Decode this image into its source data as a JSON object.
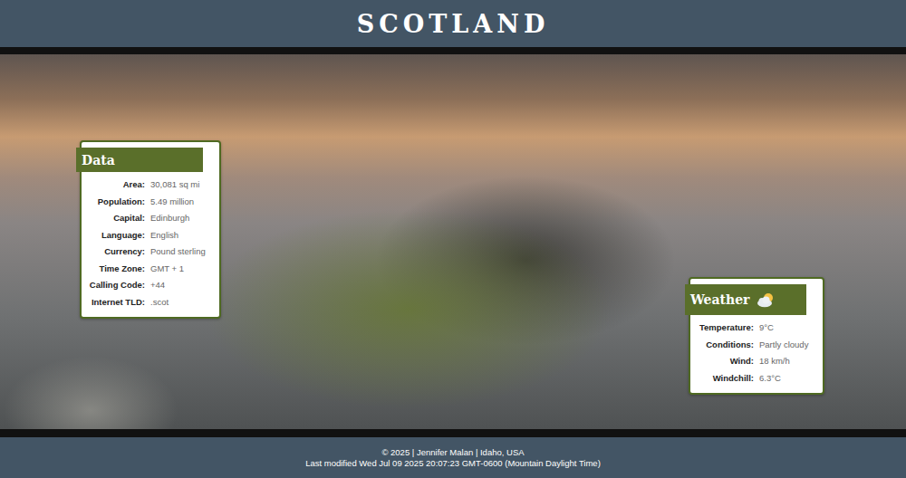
{
  "header": {
    "title": "SCOTLAND"
  },
  "data_card": {
    "title": "Data",
    "rows": [
      {
        "label": "Area:",
        "value": "30,081 sq mi"
      },
      {
        "label": "Population:",
        "value": "5.49 million"
      },
      {
        "label": "Capital:",
        "value": "Edinburgh"
      },
      {
        "label": "Language:",
        "value": "English"
      },
      {
        "label": "Currency:",
        "value": "Pound sterling"
      },
      {
        "label": "Time Zone:",
        "value": "GMT + 1"
      },
      {
        "label": "Calling Code:",
        "value": "+44"
      },
      {
        "label": "Internet TLD:",
        "value": ".scot"
      }
    ]
  },
  "weather_card": {
    "title": "Weather",
    "rows": [
      {
        "label": "Temperature:",
        "value": "9°C"
      },
      {
        "label": "Conditions:",
        "value": "Partly cloudy"
      },
      {
        "label": "Wind:",
        "value": "18 km/h"
      },
      {
        "label": "Windchill:",
        "value": "6.3°C"
      }
    ]
  },
  "footer": {
    "lines": [
      "© 2025 | Jennifer Malan | Idaho, USA",
      "Last modified Wed Jul 09 2025 20:07:23 GMT-0600 (Mountain Daylight Time)"
    ]
  }
}
